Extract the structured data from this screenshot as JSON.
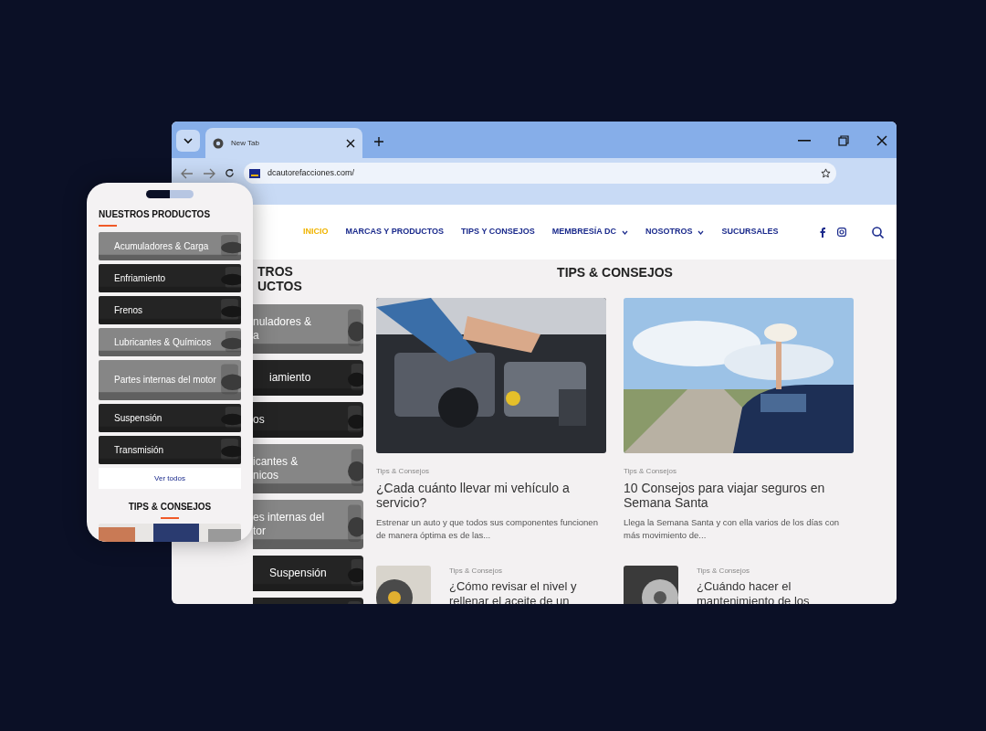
{
  "browser": {
    "tab": {
      "title": "New Tab"
    },
    "url": "dcautorefacciones.com/",
    "nav": [
      {
        "label": "INICIO",
        "selected": true,
        "dropdown": false
      },
      {
        "label": "MARCAS Y PRODUCTOS",
        "selected": false,
        "dropdown": false
      },
      {
        "label": "TIPS Y CONSEJOS",
        "selected": false,
        "dropdown": false
      },
      {
        "label": "MEMBRESÍA DC",
        "selected": false,
        "dropdown": true
      },
      {
        "label": "NOSOTROS",
        "selected": false,
        "dropdown": true
      },
      {
        "label": "SUCURSALES",
        "selected": false,
        "dropdown": false
      }
    ],
    "sidebar": {
      "title_lines": [
        "TROS",
        "UCTOS"
      ],
      "categories": [
        {
          "lines": [
            "nuladores &",
            "a"
          ]
        },
        {
          "lines": [
            "iamiento"
          ]
        },
        {
          "lines": [
            "os"
          ]
        },
        {
          "lines": [
            "icantes &",
            "nicos"
          ]
        },
        {
          "lines": [
            "es internas del",
            "tor"
          ]
        },
        {
          "lines": [
            "Suspensión"
          ]
        }
      ]
    },
    "section_title": "TIPS & CONSEJOS",
    "featured": [
      {
        "category": "Tips & Consejos",
        "title": "¿Cada cuánto llevar mi vehículo a servicio?",
        "excerpt": "Estrenar un auto y que todos sus componentes funcionen de manera óptima es de las...",
        "kind": "engine"
      },
      {
        "category": "Tips & Consejos",
        "title": "10 Consejos para viajar seguros en Semana Santa",
        "excerpt": "Llega la Semana Santa y con ella varios de los días con más movimiento de...",
        "kind": "road"
      }
    ],
    "more": [
      {
        "category": "Tips & Consejos",
        "title": "¿Cómo revisar el nivel y rellenar el aceite de un"
      },
      {
        "category": "Tips & Consejos",
        "title": "¿Cuándo hacer el mantenimiento de los"
      }
    ]
  },
  "phone": {
    "title": "NUESTROS PRODUCTOS",
    "categories": [
      {
        "label": "Acumuladores & Carga"
      },
      {
        "label": "Enfriamiento"
      },
      {
        "label": "Frenos"
      },
      {
        "label": "Lubricantes & Químicos"
      },
      {
        "label": "Partes internas del motor"
      },
      {
        "label": "Suspensión"
      },
      {
        "label": "Transmisión"
      }
    ],
    "button": "Ver todos",
    "section_title": "TIPS & CONSEJOS"
  }
}
